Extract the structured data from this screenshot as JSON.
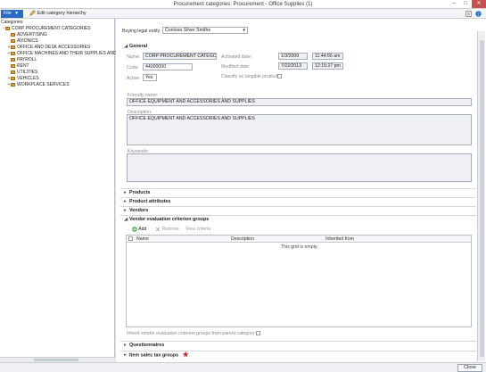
{
  "window": {
    "title": "Procurement categories: Procurement - Office Supplies (1)",
    "minimize": "–",
    "maximize": "□",
    "close": "✕"
  },
  "toolbar": {
    "file_label": "File",
    "file_arrow": "▾",
    "edit_hierarchy_label": "Edit category hierarchy"
  },
  "sidebar": {
    "header": "Categories:",
    "root": "CORP PROCUREMENT CATEGORIES",
    "items": [
      {
        "label": "ADVERTISING",
        "expander": ""
      },
      {
        "label": "AVIONICS",
        "expander": ""
      },
      {
        "label": "OFFICE AND DESK ACCESSORIES",
        "expander": "+"
      },
      {
        "label": "OFFICE MACHINES AND THEIR SUPPLIES AND",
        "expander": "+"
      },
      {
        "label": "PAYROLL",
        "expander": ""
      },
      {
        "label": "RENT",
        "expander": ""
      },
      {
        "label": "UTILITIES",
        "expander": ""
      },
      {
        "label": "VEHICLES",
        "expander": "+"
      },
      {
        "label": "WORKPLACE SERVICES",
        "expander": "+"
      }
    ]
  },
  "buying_entity": {
    "label": "Buying legal entity:",
    "value": "Contoso Silver Smiths"
  },
  "general": {
    "title": "General",
    "name_label": "Name:",
    "name_value": "CORP PROCUREMENT CATEGORIE",
    "code_label": "Code:",
    "code_value": "44000000",
    "active_label": "Active:",
    "active_value": "Yes",
    "activated_label": "Activated date:",
    "activated_date": "1/3/2009",
    "activated_time": "11:44:56 am",
    "modified_label": "Modified date:",
    "modified_date": "7/22/2013",
    "modified_time": "12:15:27 pm",
    "tangible_label": "Classify as tangible product:",
    "friendly_label": "Friendly name:",
    "friendly_value": "OFFICE EQUIPMENT AND ACCESSORIES AND SUPPLIES",
    "description_label": "Description:",
    "description_value": "OFFICE EQUIPMENT AND ACCESSORIES AND SUPPLIES",
    "keywords_label": "Keywords:"
  },
  "sections": {
    "products": "Products",
    "product_attributes": "Product attributes",
    "vendors": "Vendors",
    "vendor_eval": "Vendor evaluation criterion groups",
    "questionnaires": "Questionnaires",
    "item_sales_tax": "Item sales tax groups"
  },
  "vendor_grid": {
    "add_label": "Add",
    "remove_label": "Remove",
    "view_criteria_label": "View criteria",
    "columns": [
      "Name",
      "Description",
      "Inherited from"
    ],
    "empty_text": "This grid is empty.",
    "inherit_label": "Inherit vendor evaluation criterion groups from parent category:"
  },
  "footer": {
    "close_label": "Close"
  },
  "colors": {
    "file_button": "#2a6cc4",
    "required_star": "#d4202a"
  }
}
